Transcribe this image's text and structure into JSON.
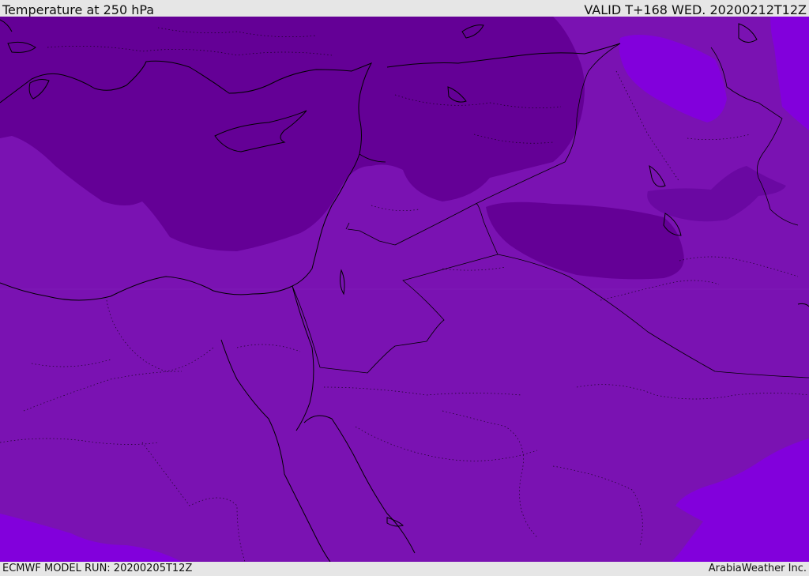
{
  "header": {
    "title": "Temperature at 250 hPa",
    "valid": "VALID T+168 WED. 20200212T12Z"
  },
  "footer": {
    "model_run": "ECMWF MODEL RUN: 20200205T12Z",
    "credit": "ArabiaWeather Inc."
  },
  "map": {
    "colors": {
      "base": "#7a12b2",
      "cold": "#640096",
      "colder": "#6a08a2",
      "warm": "#8200dc",
      "coast": "#000000"
    }
  }
}
